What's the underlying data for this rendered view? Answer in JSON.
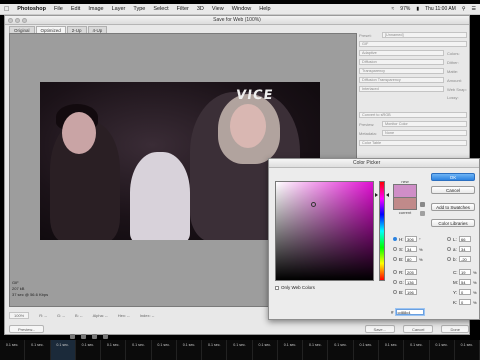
{
  "menubar": {
    "apple_icon": "apple-icon",
    "items": [
      "Photoshop",
      "File",
      "Edit",
      "Image",
      "Layer",
      "Type",
      "Select",
      "Filter",
      "3D",
      "View",
      "Window",
      "Help"
    ],
    "battery": "97%",
    "clock": "Thu 11:00 AM"
  },
  "dialog": {
    "title": "Save for Web (100%)",
    "tabs": [
      "Original",
      "Optimized",
      "2-Up",
      "4-Up"
    ],
    "active_tab": 1,
    "preview_info": [
      "GIF",
      "207 kB",
      "37 sec @ 56.6 Kbps"
    ],
    "bottom_bar": {
      "zoom": "100%",
      "r": "R: --",
      "g": "G: --",
      "b": "B: --",
      "alpha": "Alpha: --",
      "hex": "Hex: --",
      "index": "Index: --"
    },
    "buttons": {
      "preview": "Preview...",
      "save": "Save...",
      "cancel": "Cancel",
      "done": "Done"
    },
    "settings": {
      "preset_label": "Preset:",
      "preset_value": "[Unnamed]",
      "format": "GIF",
      "reduction": "Adaptive",
      "dither_algo": "Diffusion",
      "transparency": "Transparency",
      "matte_algo": "Diffusion Transparency",
      "interlaced": "Interlaced",
      "colors_label": "Colors:",
      "dither_label": "Dither:",
      "matte_label": "Matte:",
      "amount_label": "Amount:",
      "websnap_label": "Web Snap:",
      "lossy_label": "Lossy:",
      "convert_srgb": "Convert to sRGB",
      "preview_label": "Preview:",
      "preview_value": "Monitor Color",
      "metadata_label": "Metadata:",
      "metadata_value": "None",
      "color_table": "Color Table"
    }
  },
  "picker": {
    "title": "Color Picker",
    "new_label": "new",
    "current_label": "current",
    "colors": {
      "new": "#cf8ec7",
      "current": "#c08a8a"
    },
    "buttons": {
      "ok": "OK",
      "cancel": "Cancel",
      "add_swatches": "Add to Swatches",
      "libraries": "Color Libraries"
    },
    "only_web_colors": "Only Web Colors",
    "hsb": [
      {
        "label": "H:",
        "value": "306",
        "unit": "°",
        "selected": true
      },
      {
        "label": "S:",
        "value": "34",
        "unit": "%",
        "selected": false
      },
      {
        "label": "B:",
        "value": "80",
        "unit": "%",
        "selected": false
      }
    ],
    "rgb": [
      {
        "label": "R:",
        "value": "205"
      },
      {
        "label": "G:",
        "value": "136"
      },
      {
        "label": "B:",
        "value": "196"
      }
    ],
    "lab": [
      {
        "label": "L:",
        "value": "66"
      },
      {
        "label": "a:",
        "value": "34"
      },
      {
        "label": "b:",
        "value": "-20"
      }
    ],
    "cmyk": [
      {
        "label": "C:",
        "value": "19",
        "unit": "%"
      },
      {
        "label": "M:",
        "value": "54",
        "unit": "%"
      },
      {
        "label": "Y:",
        "value": "0",
        "unit": "%"
      },
      {
        "label": "K:",
        "value": "0",
        "unit": "%"
      }
    ],
    "hex_label": "#",
    "hex_value": "cd88c4"
  },
  "strip": {
    "thumbs": [
      "0.1 sec.",
      "0.1 sec.",
      "0.1 sec.",
      "0.1 sec.",
      "0.1 sec.",
      "0.1 sec.",
      "0.1 sec.",
      "0.1 sec.",
      "0.1 sec.",
      "0.1 sec.",
      "0.1 sec.",
      "0.1 sec.",
      "0.1 sec.",
      "0.1 sec.",
      "0.1 sec.",
      "0.1 sec.",
      "0.1 sec.",
      "0.1 sec.",
      "0.1 sec."
    ],
    "active": 2
  },
  "video": {
    "logo_text": "VICE"
  }
}
